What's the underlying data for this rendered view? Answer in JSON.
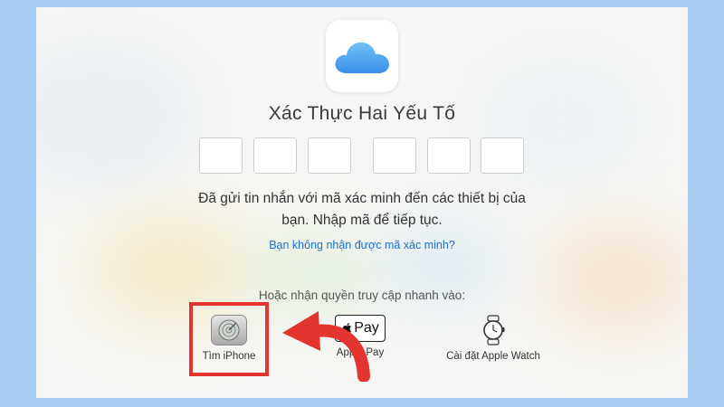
{
  "header": {
    "title": "Xác Thực Hai Yếu Tố"
  },
  "verification": {
    "message_line1": "Đã gửi tin nhắn với mã xác minh đến các thiết bị của",
    "message_line2": "bạn. Nhập mã để tiếp tục.",
    "resend_link": "Bạn không nhận được mã xác minh?"
  },
  "quick_access": {
    "label": "Hoặc nhận quyền truy cập nhanh vào:",
    "options": [
      {
        "label": "Tìm iPhone",
        "icon": "find-iphone-icon"
      },
      {
        "label": "Apple Pay",
        "icon": "apple-pay-icon",
        "badge_text": "Pay"
      },
      {
        "label": "Cài đặt Apple Watch",
        "icon": "apple-watch-icon"
      }
    ]
  },
  "colors": {
    "background": "#a9ccf3",
    "link": "#1f6fc8",
    "highlight": "#e3342f",
    "icloud_gradient_top": "#6fc3f7",
    "icloud_gradient_bottom": "#3b8de8"
  }
}
